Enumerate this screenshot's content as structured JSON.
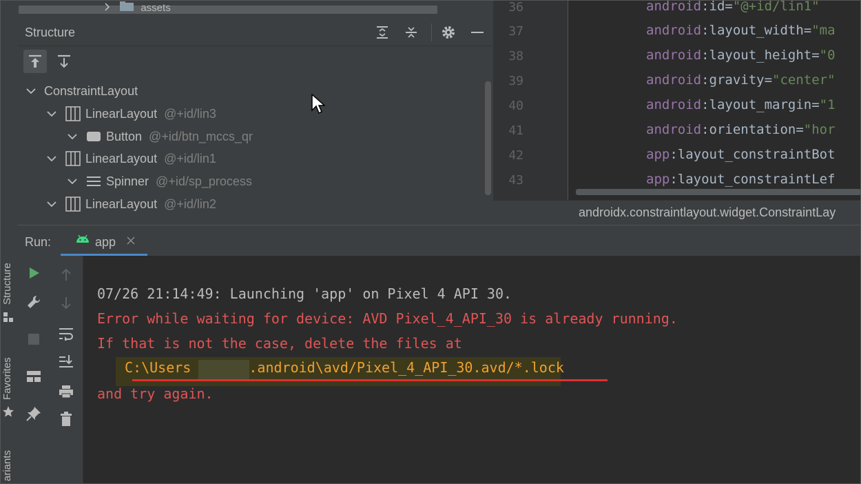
{
  "project_tree": {
    "partial_item": "assets"
  },
  "side_tabs": {
    "structure": "Structure",
    "favorites": "Favorites",
    "variants": "ariants"
  },
  "structure": {
    "title": "Structure",
    "tree": [
      {
        "label": "ConstraintLayout",
        "id": "",
        "icon": "layout-icon"
      },
      {
        "label": "LinearLayout",
        "id": "@+id/lin3",
        "icon": "linear-layout-icon"
      },
      {
        "label": "Button",
        "id": "@+id/btn_mccs_qr",
        "icon": "button-icon"
      },
      {
        "label": "LinearLayout",
        "id": "@+id/lin1",
        "icon": "linear-layout-icon"
      },
      {
        "label": "Spinner",
        "id": "@+id/sp_process",
        "icon": "spinner-icon"
      },
      {
        "label": "LinearLayout",
        "id": "@+id/lin2",
        "icon": "linear-layout-icon"
      }
    ]
  },
  "editor": {
    "lines": [
      {
        "num": "36",
        "attr": "android",
        "prop": ":id=",
        "value": "\"@+id/lin1\""
      },
      {
        "num": "37",
        "attr": "android",
        "prop": ":layout_width=",
        "value": "\"ma"
      },
      {
        "num": "38",
        "attr": "android",
        "prop": ":layout_height=",
        "value": "\"0"
      },
      {
        "num": "39",
        "attr": "android",
        "prop": ":gravity=",
        "value": "\"center\""
      },
      {
        "num": "40",
        "attr": "android",
        "prop": ":layout_margin=",
        "value": "\"1"
      },
      {
        "num": "41",
        "attr": "android",
        "prop": ":orientation=",
        "value": "\"hor"
      },
      {
        "num": "42",
        "attr": "app",
        "prop": ":layout_constraintBot",
        "value": ""
      },
      {
        "num": "43",
        "attr": "app",
        "prop": ":layout_constraintLef",
        "value": ""
      }
    ],
    "breadcrumb": "androidx.constraintlayout.widget.ConstraintLay"
  },
  "run": {
    "label": "Run:",
    "tab": "app",
    "console": {
      "line1": "07/26 21:14:49: Launching 'app' on Pixel 4 API 30.",
      "line2": "Error while waiting for device: AVD Pixel_4_API_30 is already running.",
      "line3": "If that is not the case, delete the files at",
      "path_prefix": "C:\\Users",
      "path_suffix": "\\.android\\avd/Pixel_4_API_30.avd/*.lock",
      "line5": "and try again."
    }
  },
  "colors": {
    "error_text": "#e05555",
    "path_text": "#f0a030",
    "accent_tab": "#4a88c7",
    "run_green": "#59a869"
  }
}
